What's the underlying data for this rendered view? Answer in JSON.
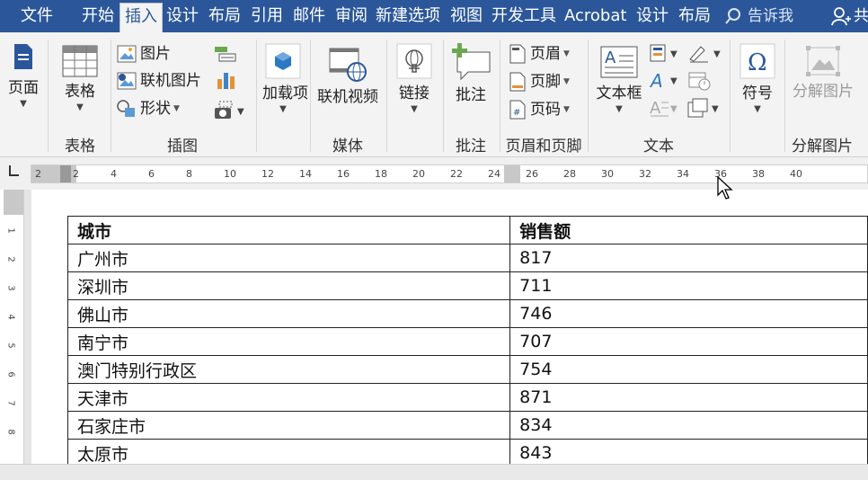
{
  "tabs": [
    {
      "label": "文件"
    },
    {
      "label": "开始"
    },
    {
      "label": "插入"
    },
    {
      "label": "设计"
    },
    {
      "label": "布局"
    },
    {
      "label": "引用"
    },
    {
      "label": "邮件"
    },
    {
      "label": "审阅"
    },
    {
      "label": "新建选项"
    },
    {
      "label": "视图"
    },
    {
      "label": "开发工具"
    },
    {
      "label": "Acrobat"
    },
    {
      "label": "设计"
    },
    {
      "label": "布局"
    }
  ],
  "tell_me": "告诉我",
  "share": "共",
  "ribbon": {
    "pages": "页面",
    "table": "表格",
    "group_table": "表格",
    "picture": "图片",
    "online_picture": "联机图片",
    "shapes": "形状",
    "group_illustrations": "插图",
    "addins": "加载项",
    "online_video": "联机视频",
    "group_media": "媒体",
    "link": "链接",
    "comment": "批注",
    "group_comment": "批注",
    "header": "页眉",
    "footer": "页脚",
    "page_number": "页码",
    "group_header_footer": "页眉和页脚",
    "textbox": "文本框",
    "group_text": "文本",
    "symbol": "符号",
    "decompose_picture": "分解图片",
    "group_decompose": "分解图片"
  },
  "ruler_ticks": [
    "2",
    "2",
    "4",
    "6",
    "8",
    "10",
    "12",
    "14",
    "16",
    "18",
    "20",
    "22",
    "24",
    "26",
    "28",
    "30",
    "32",
    "34",
    "36",
    "38",
    "40"
  ],
  "vruler_ticks": [
    "1",
    "2",
    "3",
    "4",
    "5",
    "6",
    "7",
    "8"
  ],
  "table": {
    "headers": [
      "城市",
      "销售额"
    ],
    "rows": [
      [
        "广州市",
        "817"
      ],
      [
        "深圳市",
        "711"
      ],
      [
        "佛山市",
        "746"
      ],
      [
        "南宁市",
        "707"
      ],
      [
        "澳门特别行政区",
        "754"
      ],
      [
        "天津市",
        "871"
      ],
      [
        "石家庄市",
        "834"
      ],
      [
        "太原市",
        "843"
      ]
    ]
  },
  "colors": {
    "tabbar": "#2b579a",
    "ribbon": "#f3f3f3"
  }
}
